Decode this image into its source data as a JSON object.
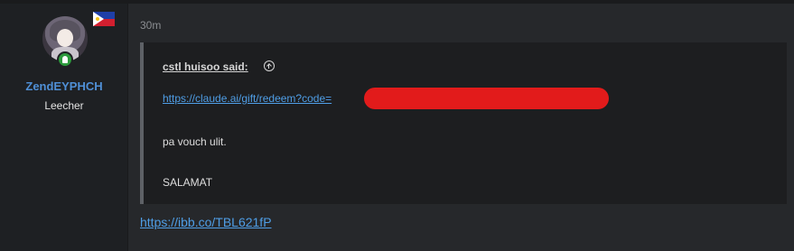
{
  "user": {
    "username": "ZendEYPHCH",
    "title": "Leecher",
    "flag_icon": "philippines-flag-icon",
    "online_icon": "online-status-icon"
  },
  "post": {
    "timestamp": "30m",
    "quote": {
      "attribution": "cstl huisoo said:",
      "jump_icon": "arrow-up-circle-icon",
      "link_text": "https://claude.ai/gift/redeem?code=",
      "line1": "pa vouch ulit.",
      "line2": "SALAMAT"
    },
    "link": "https://ibb.co/TBL621fP"
  },
  "colors": {
    "username": "#4f8fd6",
    "link": "#4f9ee6",
    "redaction": "#e21b1b",
    "online": "#2c9a3c"
  }
}
